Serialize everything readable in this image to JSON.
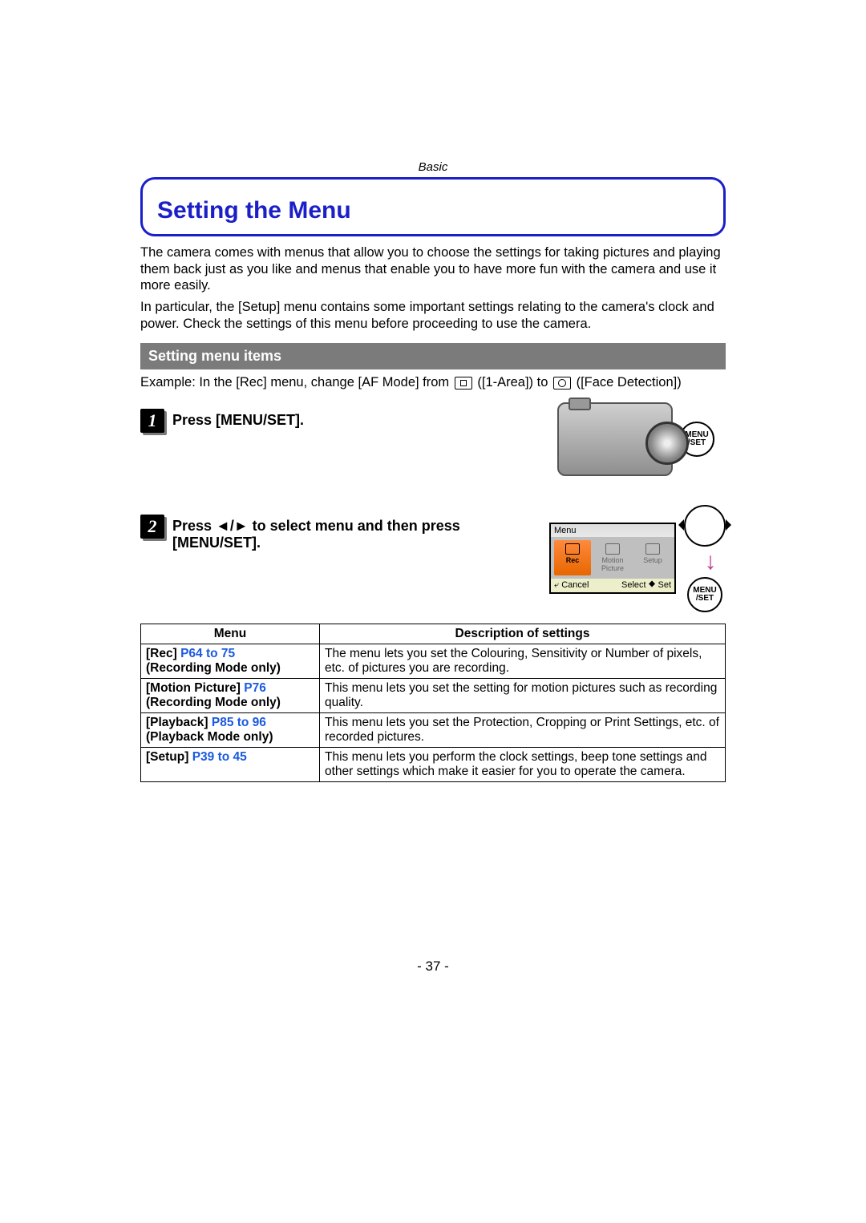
{
  "header": {
    "section": "Basic"
  },
  "title": "Setting the Menu",
  "intro": [
    "The camera comes with menus that allow you to choose the settings for taking pictures and playing them back just as you like and menus that enable you to have more fun with the camera and use it more easily.",
    "In particular, the [Setup] menu contains some important settings relating to the camera's clock and power. Check the settings of this menu before proceeding to use the camera."
  ],
  "subhead": "Setting menu items",
  "example": {
    "prefix": "Example: In the [Rec] menu, change [AF Mode] from ",
    "mid1": " ([1-Area]) to ",
    "mid2": " ([Face Detection])"
  },
  "steps": [
    {
      "num": "1",
      "text": "Press [MENU/SET]."
    },
    {
      "num": "2",
      "text": "Press ◄/► to select menu and then press [MENU/SET]."
    }
  ],
  "menuset_label": "MENU /SET",
  "lcd": {
    "title": "Menu",
    "tabs": [
      "Rec",
      "Motion Picture",
      "Setup"
    ],
    "cancel": "⤶ Cancel",
    "select": "Select ⯁ Set"
  },
  "table": {
    "header": [
      "Menu",
      "Description of settings"
    ],
    "rows": [
      {
        "name": "[Rec]",
        "pages": "P64 to 75",
        "note": "(Recording Mode only)",
        "desc": "The menu lets you set the Colouring, Sensitivity or Number of pixels, etc. of pictures you are recording."
      },
      {
        "name": "[Motion Picture]",
        "pages": "P76",
        "note": "(Recording Mode only)",
        "desc": "This menu lets you set the setting for motion pictures such as recording quality."
      },
      {
        "name": "[Playback]",
        "pages": "P85 to 96",
        "note": "(Playback Mode only)",
        "desc": "This menu lets you set the Protection, Cropping or Print Settings, etc. of recorded pictures."
      },
      {
        "name": "[Setup]",
        "pages": "P39 to 45",
        "note": "",
        "desc": "This menu lets you perform the clock settings, beep tone settings and other settings which make it easier for you to operate the camera."
      }
    ]
  },
  "page_number": "- 37 -"
}
